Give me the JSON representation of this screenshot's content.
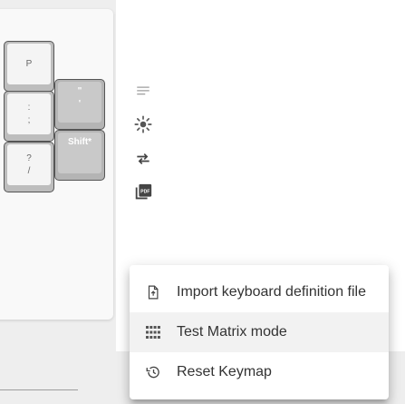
{
  "keys": [
    {
      "top": "",
      "bottom": "P"
    },
    {
      "top": ":",
      "bottom": ";"
    },
    {
      "top": "?",
      "bottom": "/"
    },
    {
      "top": "\"",
      "bottom": "'"
    },
    {
      "top": "Shift*",
      "bottom": ""
    }
  ],
  "toolbar": {
    "icons": [
      "notes-icon",
      "brightness-icon",
      "swap-icon",
      "pdf-icon"
    ]
  },
  "menu": {
    "items": [
      {
        "label": "Import keyboard definition file",
        "icon": "file-upload-icon"
      },
      {
        "label": "Test Matrix mode",
        "icon": "grid-icon"
      },
      {
        "label": "Reset Keymap",
        "icon": "history-icon"
      }
    ]
  }
}
